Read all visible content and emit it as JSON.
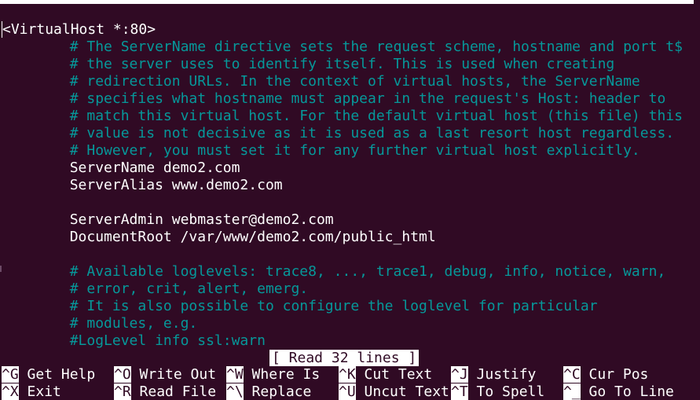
{
  "editor": {
    "lines": [
      {
        "text": "VirtualHost *:80>",
        "kind": "normal",
        "cursor": true
      },
      {
        "text": "        # The ServerName directive sets the request scheme, hostname and port t$",
        "kind": "comment"
      },
      {
        "text": "        # the server uses to identify itself. This is used when creating",
        "kind": "comment"
      },
      {
        "text": "        # redirection URLs. In the context of virtual hosts, the ServerName",
        "kind": "comment"
      },
      {
        "text": "        # specifies what hostname must appear in the request's Host: header to",
        "kind": "comment"
      },
      {
        "text": "        # match this virtual host. For the default virtual host (this file) this",
        "kind": "comment"
      },
      {
        "text": "        # value is not decisive as it is used as a last resort host regardless.",
        "kind": "comment"
      },
      {
        "text": "        # However, you must set it for any further virtual host explicitly.",
        "kind": "comment"
      },
      {
        "text": "        ServerName demo2.com",
        "kind": "normal"
      },
      {
        "text": "        ServerAlias www.demo2.com",
        "kind": "normal"
      },
      {
        "text": "",
        "kind": "normal"
      },
      {
        "text": "        ServerAdmin webmaster@demo2.com",
        "kind": "normal"
      },
      {
        "text": "        DocumentRoot /var/www/demo2.com/public_html",
        "kind": "normal"
      },
      {
        "text": "",
        "kind": "normal"
      },
      {
        "text": "        # Available loglevels: trace8, ..., trace1, debug, info, notice, warn,",
        "kind": "comment"
      },
      {
        "text": "        # error, crit, alert, emerg.",
        "kind": "comment"
      },
      {
        "text": "        # It is also possible to configure the loglevel for particular",
        "kind": "comment"
      },
      {
        "text": "        # modules, e.g.",
        "kind": "comment"
      },
      {
        "text": "        #LogLevel info ssl:warn",
        "kind": "comment"
      }
    ],
    "cursor_char": "<",
    "colors": {
      "background": "#300a24",
      "comment": "#06989a",
      "text": "#ffffff"
    }
  },
  "status": {
    "message": "[ Read 32 lines ]"
  },
  "shortcuts": {
    "row1": [
      {
        "key": "^G",
        "label": " Get Help"
      },
      {
        "key": "^O",
        "label": " Write Out"
      },
      {
        "key": "^W",
        "label": " Where Is"
      },
      {
        "key": "^K",
        "label": " Cut Text"
      },
      {
        "key": "^J",
        "label": " Justify"
      },
      {
        "key": "^C",
        "label": " Cur Pos"
      }
    ],
    "row2": [
      {
        "key": "^X",
        "label": " Exit"
      },
      {
        "key": "^R",
        "label": " Read File"
      },
      {
        "key": "^\\",
        "label": " Replace"
      },
      {
        "key": "^U",
        "label": " Uncut Text"
      },
      {
        "key": "^T",
        "label": " To Spell"
      },
      {
        "key": "^_",
        "label": " Go To Line"
      }
    ]
  }
}
